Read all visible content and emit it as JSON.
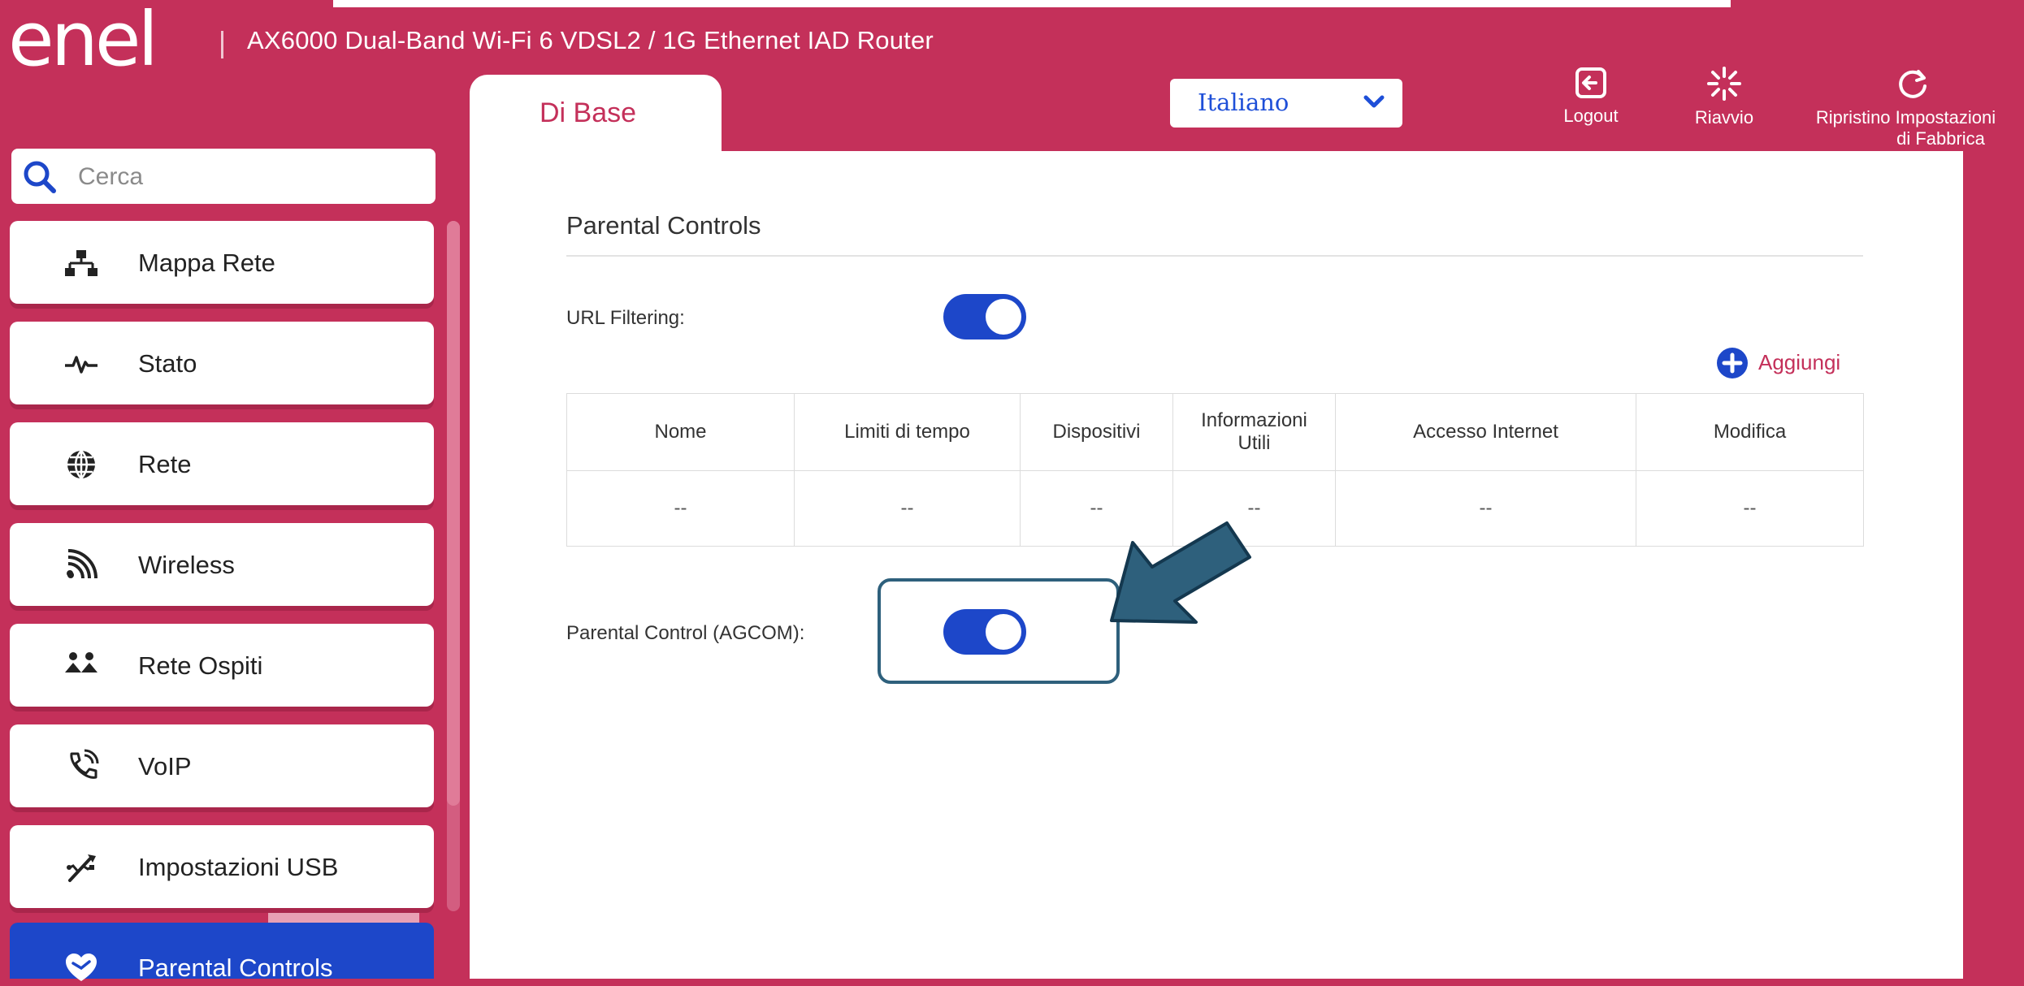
{
  "header": {
    "brand": "enel",
    "model": "AX6000 Dual-Band Wi-Fi 6 VDSL2 / 1G Ethernet IAD Router",
    "tab_label": "Di Base",
    "language": {
      "selected": "Italiano"
    },
    "buttons": [
      {
        "label": "Logout",
        "icon": "logout-icon"
      },
      {
        "label": "Riavvio",
        "icon": "reboot-icon"
      },
      {
        "label_line1": "Ripristino Impostazioni",
        "label_line2": "di Fabbrica",
        "icon": "factory-reset-icon"
      }
    ]
  },
  "sidebar": {
    "search_placeholder": "Cerca",
    "items": [
      {
        "label": "Mappa Rete",
        "icon": "network-map-icon"
      },
      {
        "label": "Stato",
        "icon": "status-pulse-icon"
      },
      {
        "label": "Rete",
        "icon": "globe-icon"
      },
      {
        "label": "Wireless",
        "icon": "wireless-icon"
      },
      {
        "label": "Rete Ospiti",
        "icon": "guest-network-icon"
      },
      {
        "label": "VoIP",
        "icon": "phone-icon"
      },
      {
        "label": "Impostazioni USB",
        "icon": "usb-icon"
      },
      {
        "label": "Parental Controls",
        "icon": "heart-icon",
        "active": true
      }
    ]
  },
  "main": {
    "section_title": "Parental Controls",
    "url_filtering": {
      "label": "URL Filtering:",
      "enabled": true
    },
    "add_label": "Aggiungi",
    "table": {
      "columns": [
        "Nome",
        "Limiti di tempo",
        "Dispositivi",
        "Informazioni Utili",
        "Accesso Internet",
        "Modifica"
      ],
      "rows": [
        [
          "--",
          "--",
          "--",
          "--",
          "--",
          "--"
        ]
      ]
    },
    "agcom": {
      "label": "Parental Control (AGCOM):",
      "enabled": true
    }
  },
  "colors": {
    "brand": "#c4305a",
    "accent": "#1d47c9",
    "highlight_box": "#2e607c"
  }
}
